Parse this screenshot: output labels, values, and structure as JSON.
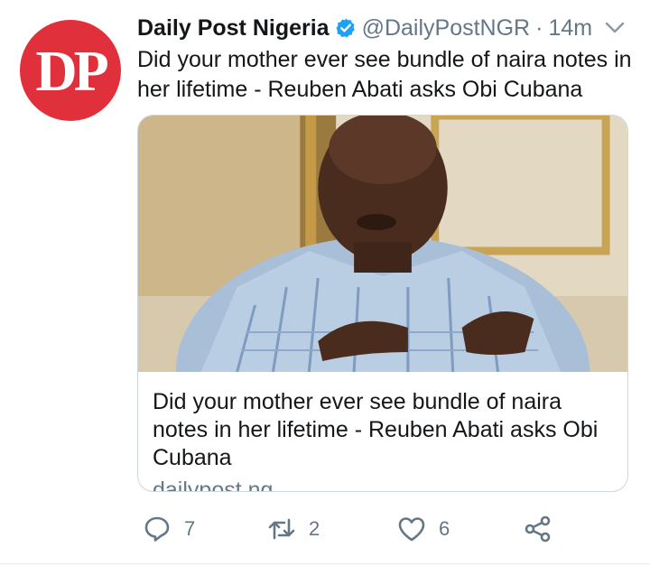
{
  "tweet": {
    "avatar_text": "DP",
    "display_name": "Daily Post Nigeria",
    "verified": true,
    "handle": "@DailyPostNGR",
    "separator": "·",
    "time": "14m",
    "text": "Did your mother ever see bundle of naira notes in her lifetime - Reuben Abati asks Obi Cubana"
  },
  "card": {
    "title": "Did your mother ever see bundle of naira notes in her lifetime - Reuben Abati asks Obi Cubana",
    "domain": "dailypost.ng"
  },
  "actions": {
    "reply_count": "7",
    "retweet_count": "2",
    "like_count": "6"
  },
  "colors": {
    "avatar_bg": "#e0303c",
    "verified_blue": "#1da1f2",
    "secondary_text": "#657786",
    "border": "#ccd6dd"
  },
  "icons": [
    "verified-badge-icon",
    "chevron-down-icon",
    "reply-icon",
    "retweet-icon",
    "like-icon",
    "share-icon"
  ]
}
